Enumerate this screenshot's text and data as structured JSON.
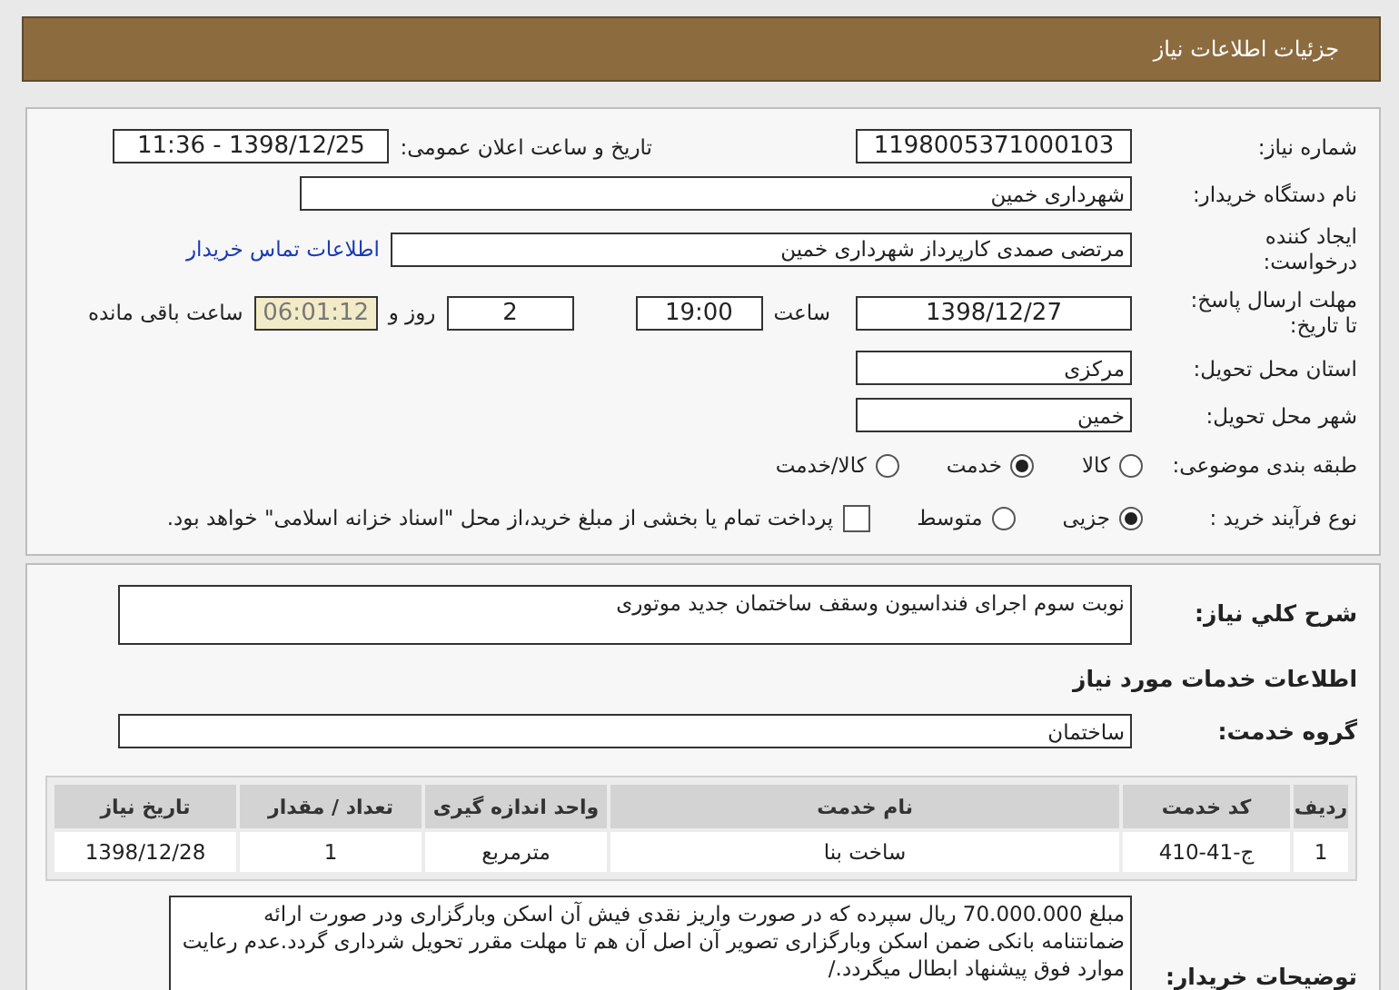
{
  "header": {
    "title": "جزئیات اطلاعات نیاز"
  },
  "need_number": {
    "label": "شماره نیاز:",
    "value": "1198005371000103"
  },
  "announce": {
    "label": "تاریخ و ساعت اعلان عمومی:",
    "value": "1398/12/25 - 11:36"
  },
  "buyer": {
    "label": "نام دستگاه خریدار:",
    "value": "شهرداری خمین"
  },
  "creator": {
    "label_lines": [
      "ایجاد کننده",
      "درخواست:"
    ],
    "value": "مرتضی صمدی کارپرداز شهرداری خمین",
    "link": "اطلاعات تماس خریدار"
  },
  "deadline": {
    "label_lines": [
      "مهلت ارسال پاسخ:",
      "تا تاریخ:"
    ],
    "date": "1398/12/27",
    "time_label": "ساعت",
    "time": "19:00",
    "days": "2",
    "days_label": "روز و",
    "remaining": "06:01:12",
    "remaining_label": "ساعت باقی مانده"
  },
  "province": {
    "label": "استان محل تحویل:",
    "value": "مرکزی"
  },
  "city": {
    "label": "شهر محل تحویل:",
    "value": "خمین"
  },
  "category": {
    "label": "طبقه بندی موضوعی:",
    "options": [
      {
        "label": "کالا",
        "selected": false
      },
      {
        "label": "خدمت",
        "selected": true
      },
      {
        "label": "کالا/خدمت",
        "selected": false
      }
    ]
  },
  "process": {
    "label": "نوع فرآیند خرید :",
    "options": [
      {
        "label": "جزیی",
        "selected": true
      },
      {
        "label": "متوسط",
        "selected": false
      }
    ],
    "payment": {
      "label": "پرداخت تمام یا بخشی از مبلغ خرید،از محل \"اسناد خزانه اسلامی\" خواهد بود.",
      "checked": false
    }
  },
  "description": {
    "label": "شرح کلي نياز:",
    "value": "نوبت سوم اجرای فنداسیون وسقف ساختمان جدید موتوری"
  },
  "services_heading": "اطلاعات خدمات مورد نیاز",
  "service_group": {
    "label": "گروه خدمت:",
    "value": "ساختمان"
  },
  "table": {
    "columns": [
      "ردیف",
      "کد خدمت",
      "نام خدمت",
      "واحد اندازه گیری",
      "تعداد / مقدار",
      "تاریخ نیاز"
    ],
    "rows": [
      [
        "1",
        "ج-41-410",
        "ساخت بنا",
        "مترمربع",
        "1",
        "1398/12/28"
      ]
    ]
  },
  "buyer_notes": {
    "label": "توضیحات خریدار:",
    "value": "مبلغ 70.000.000 ریال سپرده که در صورت واریز نقدی فیش آن اسکن وبارگزاری ودر صورت ارائه ضمانتنامه بانکی ضمن اسکن وبارگزاری تصویر آن اصل آن هم تا مهلت مقرر تحویل شرداری گردد.عدم رعایت موارد فوق پیشنهاد ابطال میگردد./"
  }
}
